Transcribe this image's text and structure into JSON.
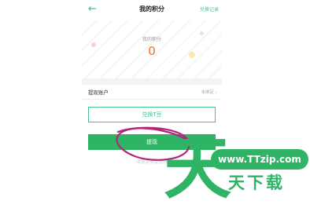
{
  "app": {
    "back_icon": "arrow-left-icon",
    "title": "我的积分",
    "top_link": "兑换记录"
  },
  "points": {
    "label": "我的积分",
    "value": "0"
  },
  "account": {
    "label": "提现账户",
    "value": "未绑定 ›"
  },
  "buttons": {
    "exchange": "兑换T豆",
    "withdraw": "提现"
  },
  "hint": "提现说明及规则",
  "watermark": {
    "url": "www.TTzip.com",
    "big": "天",
    "small": "天下载"
  },
  "colors": {
    "accent": "#2fb466",
    "points": "#f06a3d",
    "annotation": "#b0267a"
  }
}
